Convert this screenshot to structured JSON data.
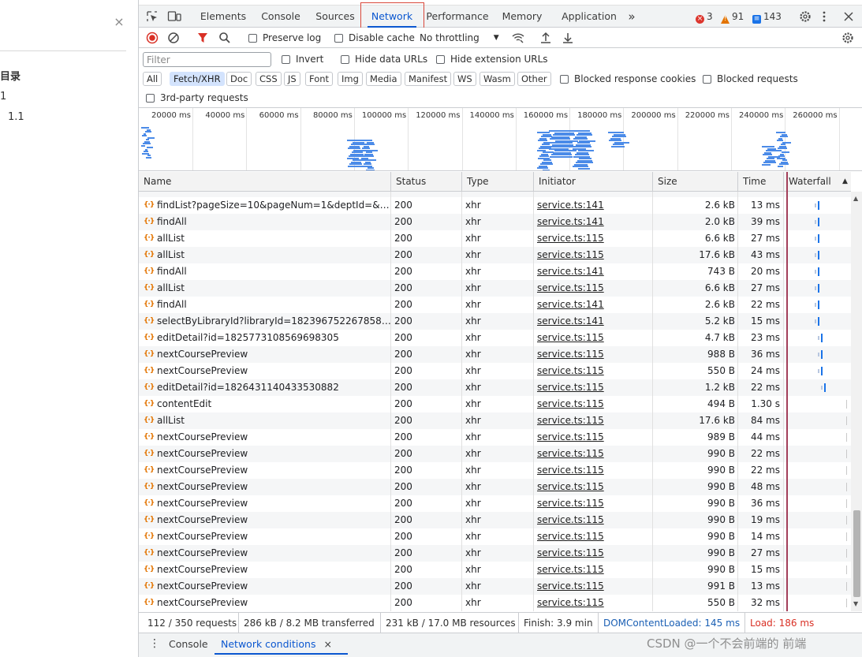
{
  "left_panel": {
    "close_glyph": "×",
    "toc_title": "目录",
    "item_1": "1",
    "item_1_1": "1.1"
  },
  "tabs": [
    {
      "label": "Elements"
    },
    {
      "label": "Console"
    },
    {
      "label": "Sources"
    },
    {
      "label": "Network"
    },
    {
      "label": "Performance"
    },
    {
      "label": "Memory"
    },
    {
      "label": "Application"
    }
  ],
  "tabs_more": "»",
  "badges": {
    "errors": "3",
    "warnings": "91",
    "messages": "143"
  },
  "toolbar": {
    "preserve_log": "Preserve log",
    "disable_cache": "Disable cache",
    "throttling": "No throttling"
  },
  "filter": {
    "placeholder": "Filter",
    "invert": "Invert",
    "hide_data_urls": "Hide data URLs",
    "hide_extension_urls": "Hide extension URLs",
    "types": [
      "All",
      "Fetch/XHR",
      "Doc",
      "CSS",
      "JS",
      "Font",
      "Img",
      "Media",
      "Manifest",
      "WS",
      "Wasm",
      "Other"
    ],
    "active_type": "Fetch/XHR",
    "blocked_response_cookies": "Blocked response cookies",
    "blocked_requests": "Blocked requests",
    "third_party": "3rd-party requests"
  },
  "overview": {
    "ticks": [
      "20000 ms",
      "40000 ms",
      "60000 ms",
      "80000 ms",
      "100000 ms",
      "120000 ms",
      "140000 ms",
      "160000 ms",
      "180000 ms",
      "200000 ms",
      "220000 ms",
      "240000 ms",
      "260000 ms"
    ]
  },
  "columns": {
    "name": "Name",
    "status": "Status",
    "type": "Type",
    "initiator": "Initiator",
    "size": "Size",
    "time": "Time",
    "waterfall": "Waterfall"
  },
  "requests": [
    {
      "name": "findList?pageSize=10&pageNum=1&deptId=&u...",
      "status": "200",
      "type": "xhr",
      "initiator": "service.ts:141",
      "size": "2.6 kB",
      "time": "13 ms",
      "wf": 0.5
    },
    {
      "name": "findAll",
      "status": "200",
      "type": "xhr",
      "initiator": "service.ts:141",
      "size": "2.0 kB",
      "time": "39 ms",
      "wf": 0.5
    },
    {
      "name": "allList",
      "status": "200",
      "type": "xhr",
      "initiator": "service.ts:115",
      "size": "6.6 kB",
      "time": "27 ms",
      "wf": 0.5
    },
    {
      "name": "allList",
      "status": "200",
      "type": "xhr",
      "initiator": "service.ts:115",
      "size": "17.6 kB",
      "time": "43 ms",
      "wf": 0.5
    },
    {
      "name": "findAll",
      "status": "200",
      "type": "xhr",
      "initiator": "service.ts:141",
      "size": "743 B",
      "time": "20 ms",
      "wf": 0.5
    },
    {
      "name": "allList",
      "status": "200",
      "type": "xhr",
      "initiator": "service.ts:115",
      "size": "6.6 kB",
      "time": "27 ms",
      "wf": 0.5
    },
    {
      "name": "findAll",
      "status": "200",
      "type": "xhr",
      "initiator": "service.ts:141",
      "size": "2.6 kB",
      "time": "22 ms",
      "wf": 0.5
    },
    {
      "name": "selectByLibraryId?libraryId=18239675226785873...",
      "status": "200",
      "type": "xhr",
      "initiator": "service.ts:141",
      "size": "5.2 kB",
      "time": "15 ms",
      "wf": 0.5
    },
    {
      "name": "editDetail?id=1825773108569698305",
      "status": "200",
      "type": "xhr",
      "initiator": "service.ts:115",
      "size": "4.7 kB",
      "time": "23 ms",
      "wf": 0.55
    },
    {
      "name": "nextCoursePreview",
      "status": "200",
      "type": "xhr",
      "initiator": "service.ts:115",
      "size": "988 B",
      "time": "36 ms",
      "wf": 0.55
    },
    {
      "name": "nextCoursePreview",
      "status": "200",
      "type": "xhr",
      "initiator": "service.ts:115",
      "size": "550 B",
      "time": "24 ms",
      "wf": 0.55
    },
    {
      "name": "editDetail?id=1826431140433530882",
      "status": "200",
      "type": "xhr",
      "initiator": "service.ts:115",
      "size": "1.2 kB",
      "time": "22 ms",
      "wf": 0.6
    },
    {
      "name": "contentEdit",
      "status": "200",
      "type": "xhr",
      "initiator": "service.ts:115",
      "size": "494 B",
      "time": "1.30 s",
      "wf": 0.95
    },
    {
      "name": "allList",
      "status": "200",
      "type": "xhr",
      "initiator": "service.ts:115",
      "size": "17.6 kB",
      "time": "84 ms",
      "wf": 0.95
    },
    {
      "name": "nextCoursePreview",
      "status": "200",
      "type": "xhr",
      "initiator": "service.ts:115",
      "size": "989 B",
      "time": "44 ms",
      "wf": 0.95
    },
    {
      "name": "nextCoursePreview",
      "status": "200",
      "type": "xhr",
      "initiator": "service.ts:115",
      "size": "990 B",
      "time": "22 ms",
      "wf": 0.95
    },
    {
      "name": "nextCoursePreview",
      "status": "200",
      "type": "xhr",
      "initiator": "service.ts:115",
      "size": "990 B",
      "time": "22 ms",
      "wf": 0.95
    },
    {
      "name": "nextCoursePreview",
      "status": "200",
      "type": "xhr",
      "initiator": "service.ts:115",
      "size": "990 B",
      "time": "48 ms",
      "wf": 0.95
    },
    {
      "name": "nextCoursePreview",
      "status": "200",
      "type": "xhr",
      "initiator": "service.ts:115",
      "size": "990 B",
      "time": "36 ms",
      "wf": 0.95
    },
    {
      "name": "nextCoursePreview",
      "status": "200",
      "type": "xhr",
      "initiator": "service.ts:115",
      "size": "990 B",
      "time": "19 ms",
      "wf": 0.95
    },
    {
      "name": "nextCoursePreview",
      "status": "200",
      "type": "xhr",
      "initiator": "service.ts:115",
      "size": "990 B",
      "time": "14 ms",
      "wf": 0.95
    },
    {
      "name": "nextCoursePreview",
      "status": "200",
      "type": "xhr",
      "initiator": "service.ts:115",
      "size": "990 B",
      "time": "27 ms",
      "wf": 0.95
    },
    {
      "name": "nextCoursePreview",
      "status": "200",
      "type": "xhr",
      "initiator": "service.ts:115",
      "size": "990 B",
      "time": "15 ms",
      "wf": 0.95
    },
    {
      "name": "nextCoursePreview",
      "status": "200",
      "type": "xhr",
      "initiator": "service.ts:115",
      "size": "991 B",
      "time": "13 ms",
      "wf": 0.95
    },
    {
      "name": "nextCoursePreview",
      "status": "200",
      "type": "xhr",
      "initiator": "service.ts:115",
      "size": "550 B",
      "time": "32 ms",
      "wf": 0.95
    }
  ],
  "status": {
    "requests": "112 / 350 requests",
    "transferred": "286 kB / 8.2 MB transferred",
    "resources": "231 kB / 17.0 MB resources",
    "finish": "Finish: 3.9 min",
    "dcl": "DOMContentLoaded: 145 ms",
    "load": "Load: 186 ms"
  },
  "drawer": {
    "menu_glyph": "⋮",
    "console": "Console",
    "network_conditions": "Network conditions",
    "close_glyph": "×"
  },
  "watermark": "CSDN @一个不会前端的 前端",
  "colors": {
    "accent": "#0b57d0",
    "dcl": "#1a5fb4",
    "load": "#d93025",
    "error": "#dc362e",
    "warning": "#e37400",
    "message": "#1a73e8"
  }
}
